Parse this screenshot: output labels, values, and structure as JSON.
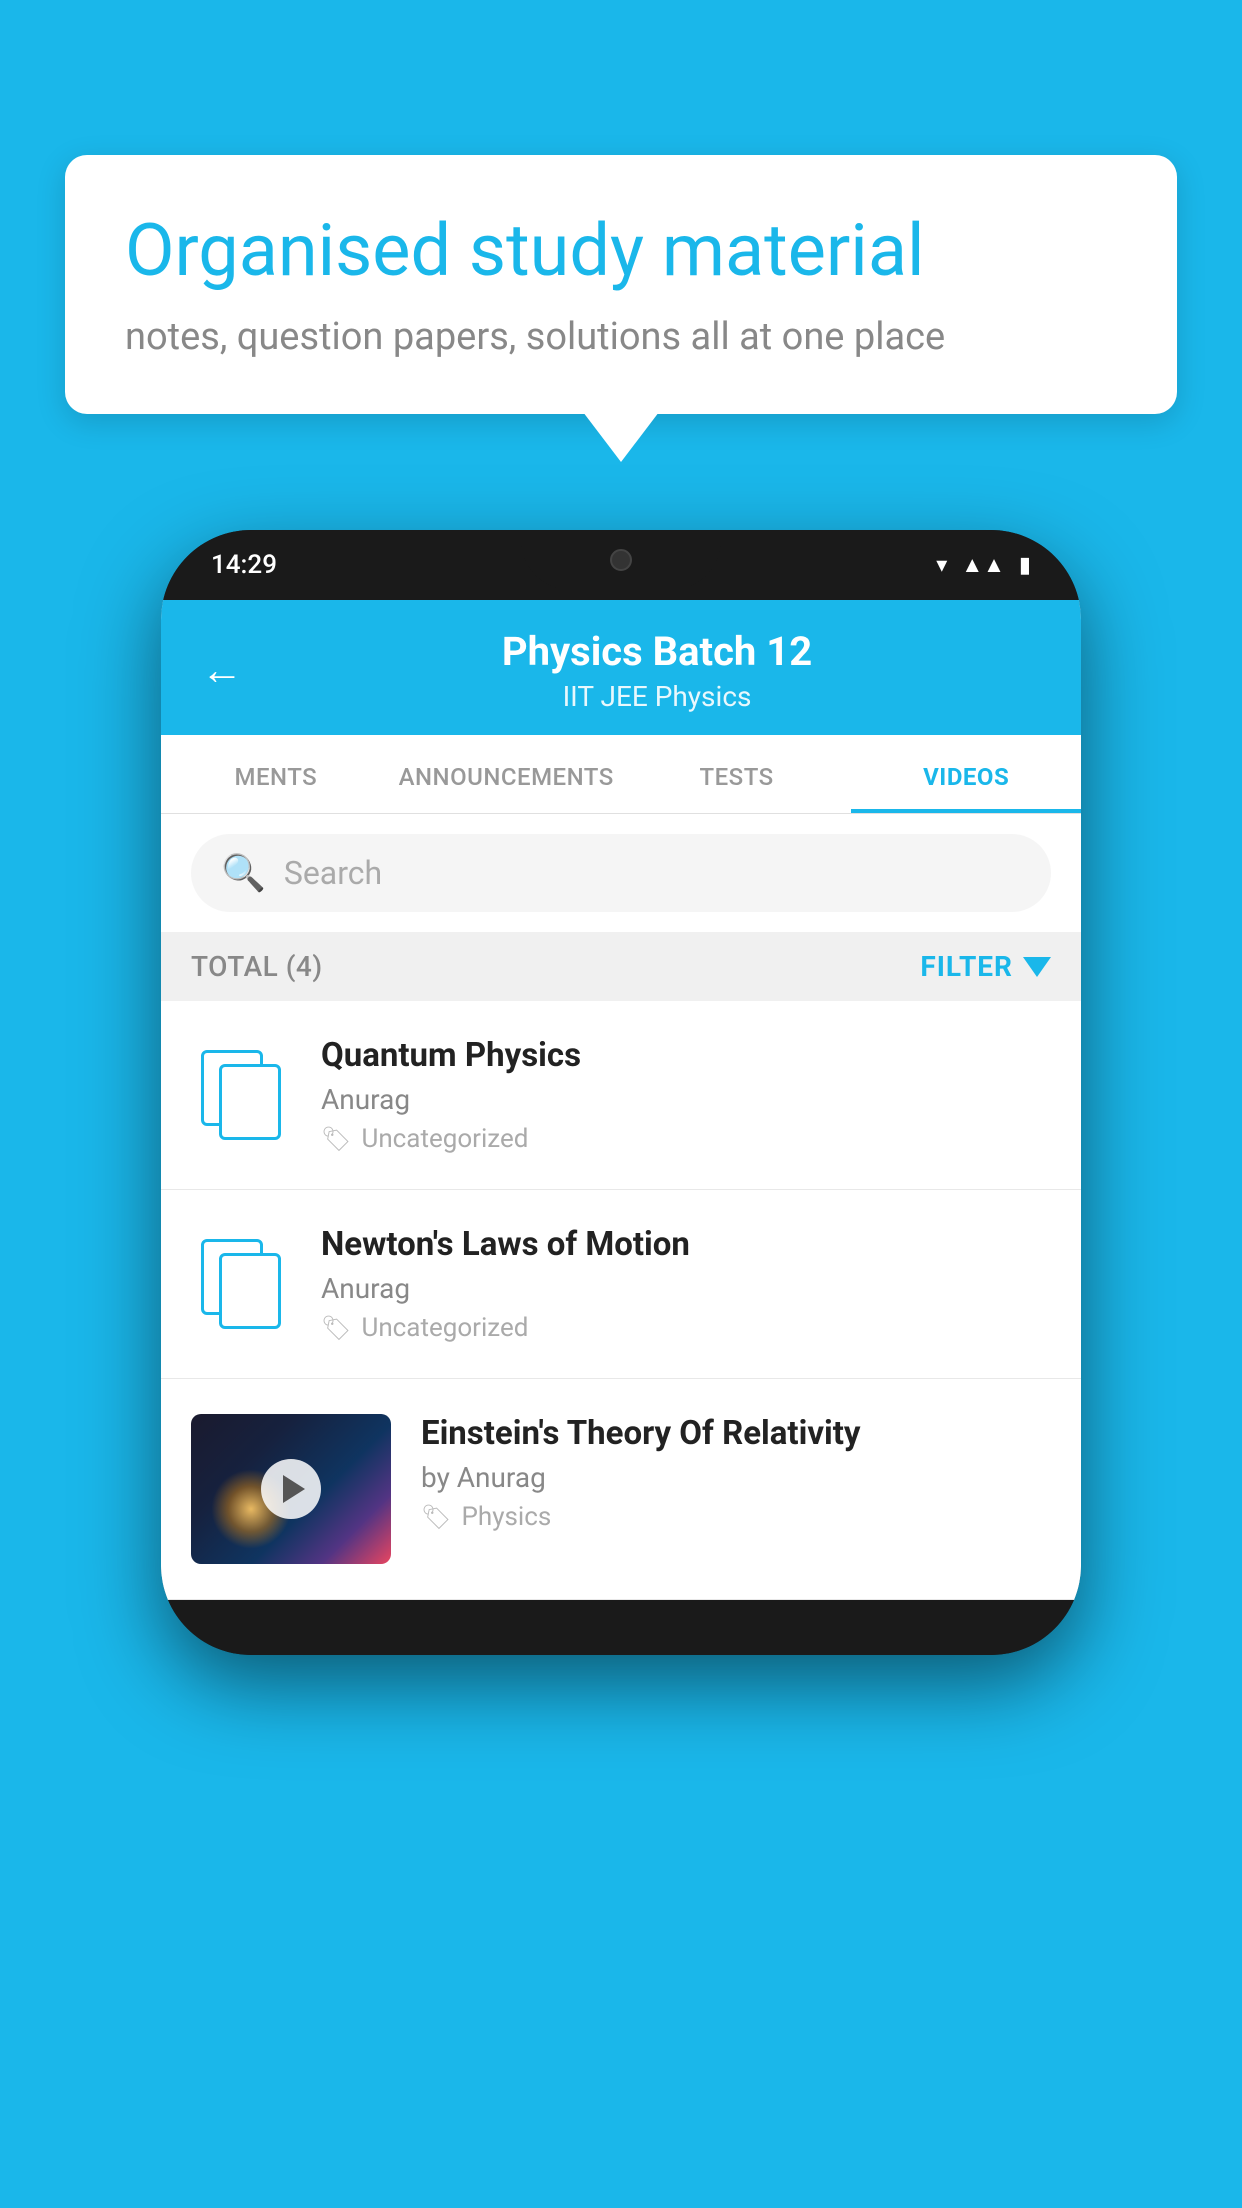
{
  "background_color": "#1ab7ea",
  "speech_bubble": {
    "title": "Organised study material",
    "subtitle": "notes, question papers, solutions all at one place"
  },
  "phone": {
    "status_bar": {
      "time": "14:29"
    },
    "header": {
      "title": "Physics Batch 12",
      "subtitle": "IIT JEE   Physics"
    },
    "tabs": [
      {
        "label": "MENTS",
        "active": false
      },
      {
        "label": "ANNOUNCEMENTS",
        "active": false
      },
      {
        "label": "TESTS",
        "active": false
      },
      {
        "label": "VIDEOS",
        "active": true
      }
    ],
    "search": {
      "placeholder": "Search"
    },
    "filter_bar": {
      "total_label": "TOTAL (4)",
      "filter_label": "FILTER"
    },
    "videos": [
      {
        "title": "Quantum Physics",
        "author": "Anurag",
        "tag": "Uncategorized",
        "has_thumbnail": false
      },
      {
        "title": "Newton's Laws of Motion",
        "author": "Anurag",
        "tag": "Uncategorized",
        "has_thumbnail": false
      },
      {
        "title": "Einstein's Theory Of Relativity",
        "author": "by Anurag",
        "tag": "Physics",
        "has_thumbnail": true
      }
    ]
  }
}
